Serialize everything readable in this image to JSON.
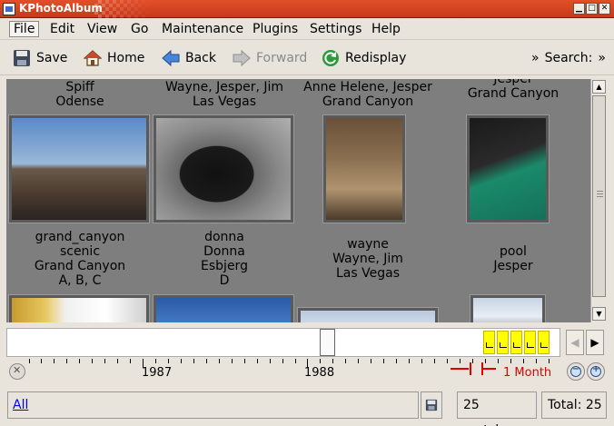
{
  "window": {
    "title": "KPhotoAlbum"
  },
  "menu": [
    "File",
    "Edit",
    "View",
    "Go",
    "Maintenance",
    "Plugins",
    "Settings",
    "Help"
  ],
  "toolbar": {
    "save": "Save",
    "home": "Home",
    "back": "Back",
    "forward": "Forward",
    "redisplay": "Redisplay",
    "overflow": "»",
    "search_label": "Search:",
    "search_overflow": "»"
  },
  "thumbnails": [
    {
      "lines": [
        "Spiff",
        "Odense"
      ]
    },
    {
      "lines": [
        "Wayne, Jesper, Jim",
        "Las Vegas"
      ]
    },
    {
      "lines": [
        "Anne Helene, Jesper",
        "Grand Canyon"
      ]
    },
    {
      "lines": [
        "Jesper",
        "Grand Canyon"
      ]
    },
    {
      "lines": [
        "grand_canyon",
        "scenic",
        "Grand Canyon",
        "A, B, C"
      ]
    },
    {
      "lines": [
        "donna",
        "Donna",
        "Esbjerg",
        "D"
      ]
    },
    {
      "lines": [
        "wayne",
        "Wayne, Jim",
        "Las Vegas"
      ]
    },
    {
      "lines": [
        "pool",
        "Jesper"
      ]
    }
  ],
  "timeline": {
    "years": [
      "1987",
      "1988"
    ],
    "span_label": "1 Month"
  },
  "status": {
    "filter": "All",
    "matches": "25 matches",
    "total": "Total: 25"
  },
  "colors": {
    "titlebar": "#d5432a",
    "thumb_bg": "#7e7e7e",
    "timeline_bar": "#ffff00",
    "span": "#e00000",
    "link": "#0000ee"
  }
}
